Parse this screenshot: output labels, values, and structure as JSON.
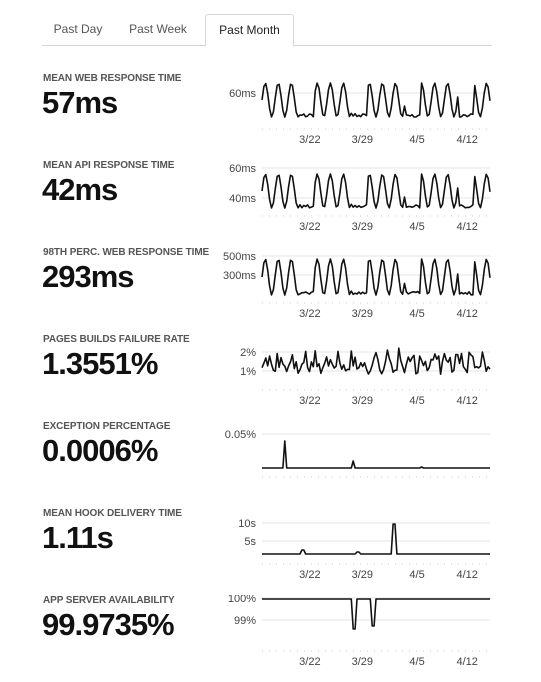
{
  "tabs": [
    {
      "label": "Past Day",
      "active": false
    },
    {
      "label": "Past Week",
      "active": false
    },
    {
      "label": "Past Month",
      "active": true
    }
  ],
  "colors": {
    "line": "#111111",
    "grid": "#e4e4e4",
    "accent": "#222222"
  },
  "x_axis": {
    "ticks": [
      {
        "label": "3/22",
        "pos": 0.21
      },
      {
        "label": "3/29",
        "pos": 0.44
      },
      {
        "label": "4/5",
        "pos": 0.68
      },
      {
        "label": "4/12",
        "pos": 0.9
      }
    ]
  },
  "metrics": [
    {
      "label": "MEAN WEB RESPONSE TIME",
      "value": "57ms",
      "ticks": [
        "60ms"
      ],
      "show_x": true
    },
    {
      "label": "MEAN API RESPONSE TIME",
      "value": "42ms",
      "ticks": [
        "60ms",
        "40ms"
      ],
      "show_x": true
    },
    {
      "label": "98TH PERC. WEB RESPONSE TIME",
      "value": "293ms",
      "ticks": [
        "500ms",
        "300ms"
      ],
      "show_x": true
    },
    {
      "label": "PAGES BUILDS FAILURE RATE",
      "value": "1.3551%",
      "ticks": [
        "2%",
        "1%"
      ],
      "show_x": true
    },
    {
      "label": "EXCEPTION PERCENTAGE",
      "value": "0.0006%",
      "ticks": [
        "0.05%"
      ],
      "show_x": false
    },
    {
      "label": "MEAN HOOK DELIVERY TIME",
      "value": "1.11s",
      "ticks": [
        "10s",
        "5s"
      ],
      "show_x": true
    },
    {
      "label": "APP SERVER AVAILABILITY",
      "value": "99.9735%",
      "ticks": [
        "100%",
        "99%"
      ],
      "show_x": true
    }
  ]
}
